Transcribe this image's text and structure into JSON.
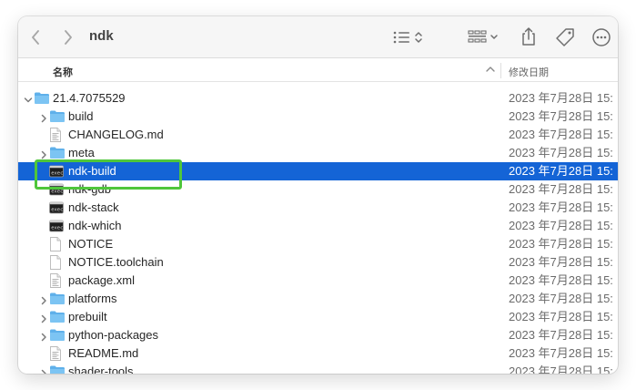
{
  "toolbar": {
    "title": "ndk",
    "back_icon": "chevron-left-icon",
    "forward_icon": "chevron-right-icon",
    "view_icon": "list-view-icon",
    "group_icon": "grid-group-icon",
    "share_icon": "share-icon",
    "tag_icon": "tag-icon",
    "more_icon": "ellipsis-circle-icon"
  },
  "columns": {
    "name": "名称",
    "date_modified": "修改日期"
  },
  "colors": {
    "selection": "#1464d6",
    "highlight_box": "#4fc63b",
    "folder": "#5fb0ea"
  },
  "rows": [
    {
      "name": "21.4.7075529",
      "date": "2023 年7月28日 15:",
      "kind": "folder",
      "disclosure": "expanded",
      "level": 0
    },
    {
      "name": "build",
      "date": "2023 年7月28日 15:",
      "kind": "folder",
      "disclosure": "collapsed",
      "level": 1
    },
    {
      "name": "CHANGELOG.md",
      "date": "2023 年7月28日 15:",
      "kind": "document",
      "disclosure": "none",
      "level": 1
    },
    {
      "name": "meta",
      "date": "2023 年7月28日 15:",
      "kind": "folder",
      "disclosure": "collapsed",
      "level": 1
    },
    {
      "name": "ndk-build",
      "date": "2023 年7月28日 15:",
      "kind": "executable",
      "disclosure": "none",
      "level": 1,
      "selected": true
    },
    {
      "name": "ndk-gdb",
      "date": "2023 年7月28日 15:",
      "kind": "executable",
      "disclosure": "none",
      "level": 1
    },
    {
      "name": "ndk-stack",
      "date": "2023 年7月28日 15:",
      "kind": "executable",
      "disclosure": "none",
      "level": 1
    },
    {
      "name": "ndk-which",
      "date": "2023 年7月28日 15:",
      "kind": "executable",
      "disclosure": "none",
      "level": 1
    },
    {
      "name": "NOTICE",
      "date": "2023 年7月28日 15:",
      "kind": "blank",
      "disclosure": "none",
      "level": 1
    },
    {
      "name": "NOTICE.toolchain",
      "date": "2023 年7月28日 15:",
      "kind": "blank",
      "disclosure": "none",
      "level": 1
    },
    {
      "name": "package.xml",
      "date": "2023 年7月28日 15:",
      "kind": "document",
      "disclosure": "none",
      "level": 1
    },
    {
      "name": "platforms",
      "date": "2023 年7月28日 15:",
      "kind": "folder",
      "disclosure": "collapsed",
      "level": 1
    },
    {
      "name": "prebuilt",
      "date": "2023 年7月28日 15:",
      "kind": "folder",
      "disclosure": "collapsed",
      "level": 1
    },
    {
      "name": "python-packages",
      "date": "2023 年7月28日 15:",
      "kind": "folder",
      "disclosure": "collapsed",
      "level": 1
    },
    {
      "name": "README.md",
      "date": "2023 年7月28日 15:",
      "kind": "document",
      "disclosure": "none",
      "level": 1
    },
    {
      "name": "shader-tools",
      "date": "2023 年7月28日 15:",
      "kind": "folder",
      "disclosure": "collapsed",
      "level": 1
    }
  ]
}
